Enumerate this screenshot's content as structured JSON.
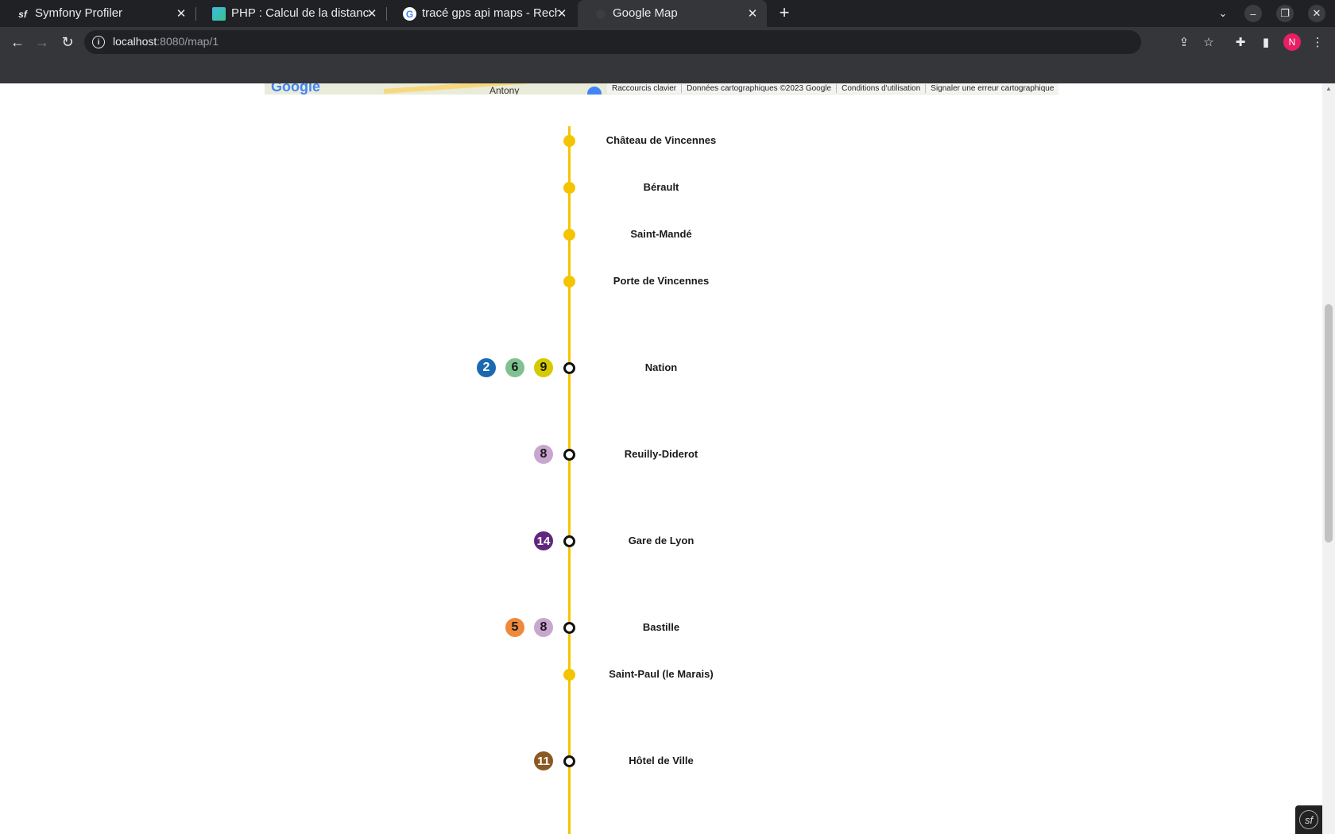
{
  "tabs": [
    {
      "title": "Symfony Profiler",
      "icon": "symfony-icon",
      "active": false
    },
    {
      "title": "PHP : Calcul de la distance",
      "icon": "site-icon",
      "active": false
    },
    {
      "title": "tracé gps api maps - Reche",
      "icon": "google-icon",
      "active": false
    },
    {
      "title": "Google Map",
      "icon": "globe-icon",
      "active": true
    }
  ],
  "address": {
    "host": "localhost",
    "rest": ":8080/map/1"
  },
  "profile_initial": "N",
  "map_footer": {
    "place": "Antony",
    "keyboard": "Raccourcis clavier",
    "data": "Données cartographiques ©2023 Google",
    "terms": "Conditions d'utilisation",
    "report": "Signaler une erreur cartographique"
  },
  "line_color": "#f5c400",
  "stations": [
    {
      "name": "Château de Vincennes",
      "correspondence": false,
      "lines": []
    },
    {
      "name": "Bérault",
      "correspondence": false,
      "lines": []
    },
    {
      "name": "Saint-Mandé",
      "correspondence": false,
      "lines": []
    },
    {
      "name": "Porte de Vincennes",
      "correspondence": false,
      "lines": []
    },
    {
      "name": "Nation",
      "correspondence": true,
      "lines": [
        {
          "num": "2",
          "bg": "#1b6ab0",
          "fg": "#ffffff"
        },
        {
          "num": "6",
          "bg": "#7fc18f",
          "fg": "#1a1a1a"
        },
        {
          "num": "9",
          "bg": "#d5c900",
          "fg": "#1a1a1a"
        }
      ]
    },
    {
      "name": "Reuilly-Diderot",
      "correspondence": true,
      "lines": [
        {
          "num": "8",
          "bg": "#c9a6cf",
          "fg": "#1a1a1a"
        }
      ]
    },
    {
      "name": "Gare de Lyon",
      "correspondence": true,
      "lines": [
        {
          "num": "14",
          "bg": "#62267f",
          "fg": "#ffffff"
        }
      ]
    },
    {
      "name": "Bastille",
      "correspondence": true,
      "lines": [
        {
          "num": "5",
          "bg": "#ef8a3c",
          "fg": "#1a1a1a"
        },
        {
          "num": "8",
          "bg": "#c9a6cf",
          "fg": "#1a1a1a"
        }
      ]
    },
    {
      "name": "Saint-Paul (le Marais)",
      "correspondence": false,
      "lines": []
    },
    {
      "name": "Hôtel de Ville",
      "correspondence": true,
      "lines": [
        {
          "num": "11",
          "bg": "#8a5a23",
          "fg": "#ffffff"
        }
      ]
    }
  ]
}
